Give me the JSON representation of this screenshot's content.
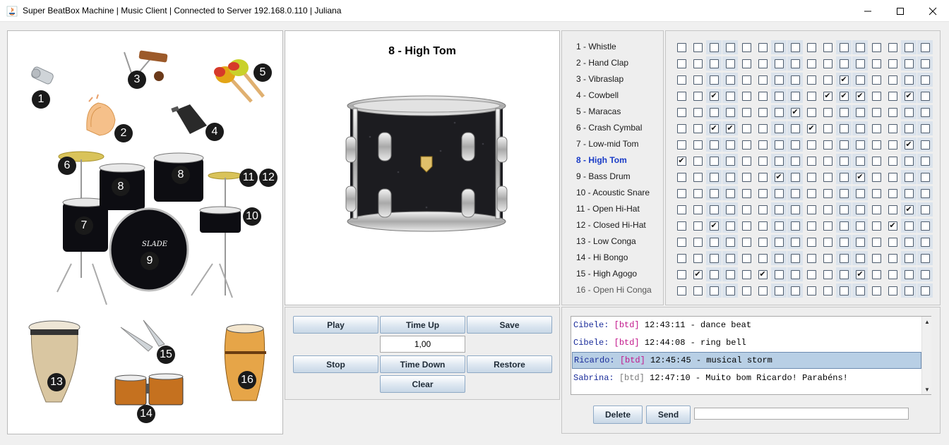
{
  "window": {
    "title": "Super BeatBox Machine | Music Client | Connected to Server 192.168.0.110 | Juliana"
  },
  "instrument_image": {
    "badges": [
      "1",
      "2",
      "3",
      "4",
      "5",
      "6",
      "7",
      "8",
      "8",
      "9",
      "10",
      "11",
      "12",
      "13",
      "14",
      "15",
      "16"
    ],
    "brand": "SLADE"
  },
  "preview": {
    "title": "8 - High Tom"
  },
  "controls": {
    "play": "Play",
    "time_up": "Time Up",
    "save": "Save",
    "tempo": "1,00",
    "stop": "Stop",
    "time_down": "Time Down",
    "restore": "Restore",
    "clear": "Clear"
  },
  "instruments": [
    "1 - Whistle",
    "2 - Hand Clap",
    "3 - Vibraslap",
    "4 - Cowbell",
    "5 - Maracas",
    "6 - Crash Cymbal",
    "7 - Low-mid Tom",
    "8 - High Tom",
    "9 - Bass Drum",
    "10 - Acoustic Snare",
    "11 - Open Hi-Hat",
    "12 - Closed Hi-Hat",
    "13 - Low Conga",
    "14 - Hi Bongo",
    "15 - High Agogo",
    "16 - Open Hi Conga"
  ],
  "selected_instrument_index": 7,
  "grid": [
    [
      0,
      0,
      0,
      0,
      0,
      0,
      0,
      0,
      0,
      0,
      0,
      0,
      0,
      0,
      0,
      0
    ],
    [
      0,
      0,
      0,
      0,
      0,
      0,
      0,
      0,
      0,
      0,
      0,
      0,
      0,
      0,
      0,
      0
    ],
    [
      0,
      0,
      0,
      0,
      0,
      0,
      0,
      0,
      0,
      0,
      1,
      0,
      0,
      0,
      0,
      0
    ],
    [
      0,
      0,
      1,
      0,
      0,
      0,
      0,
      0,
      0,
      1,
      1,
      1,
      0,
      0,
      1,
      0
    ],
    [
      0,
      0,
      0,
      0,
      0,
      0,
      0,
      1,
      0,
      0,
      0,
      0,
      0,
      0,
      0,
      0
    ],
    [
      0,
      0,
      1,
      1,
      0,
      0,
      0,
      0,
      1,
      0,
      0,
      0,
      0,
      0,
      0,
      0
    ],
    [
      0,
      0,
      0,
      0,
      0,
      0,
      0,
      0,
      0,
      0,
      0,
      0,
      0,
      0,
      1,
      0
    ],
    [
      1,
      0,
      0,
      0,
      0,
      0,
      0,
      0,
      0,
      0,
      0,
      0,
      0,
      0,
      0,
      0
    ],
    [
      0,
      0,
      0,
      0,
      0,
      0,
      1,
      0,
      0,
      0,
      0,
      1,
      0,
      0,
      0,
      0
    ],
    [
      0,
      0,
      0,
      0,
      0,
      0,
      0,
      0,
      0,
      0,
      0,
      0,
      0,
      0,
      0,
      0
    ],
    [
      0,
      0,
      0,
      0,
      0,
      0,
      0,
      0,
      0,
      0,
      0,
      0,
      0,
      0,
      1,
      0
    ],
    [
      0,
      0,
      1,
      0,
      0,
      0,
      0,
      0,
      0,
      0,
      0,
      0,
      0,
      1,
      0,
      0
    ],
    [
      0,
      0,
      0,
      0,
      0,
      0,
      0,
      0,
      0,
      0,
      0,
      0,
      0,
      0,
      0,
      0
    ],
    [
      0,
      0,
      0,
      0,
      0,
      0,
      0,
      0,
      0,
      0,
      0,
      0,
      0,
      0,
      0,
      0
    ],
    [
      0,
      1,
      0,
      0,
      0,
      1,
      0,
      0,
      0,
      0,
      0,
      1,
      0,
      0,
      0,
      0
    ],
    [
      0,
      0,
      0,
      0,
      0,
      0,
      0,
      0,
      0,
      0,
      0,
      0,
      0,
      0,
      0,
      0
    ]
  ],
  "chat": {
    "messages": [
      {
        "user": "Cibele:",
        "tag": "[btd]",
        "time": "12:43:11",
        "text": "- dance beat",
        "tag_color": "pink",
        "selected": false
      },
      {
        "user": "Cibele:",
        "tag": "[btd]",
        "time": "12:44:08",
        "text": "- ring bell",
        "tag_color": "pink",
        "selected": false
      },
      {
        "user": "Ricardo:",
        "tag": "[btd]",
        "time": "12:45:45",
        "text": "- musical storm",
        "tag_color": "pink",
        "selected": true
      },
      {
        "user": "Sabrina:",
        "tag": "[btd]",
        "time": "12:47:10",
        "text": "- Muito bom Ricardo! Parabéns!",
        "tag_color": "gray",
        "selected": false
      }
    ],
    "delete": "Delete",
    "send": "Send",
    "input_value": ""
  },
  "colors": {
    "accent_selected": "#1a3cc7",
    "tag_pink": "#c2188c",
    "chat_user": "#1a2c9a",
    "selection_bg": "#b8cfe5",
    "button_border": "#8ea9c5"
  }
}
